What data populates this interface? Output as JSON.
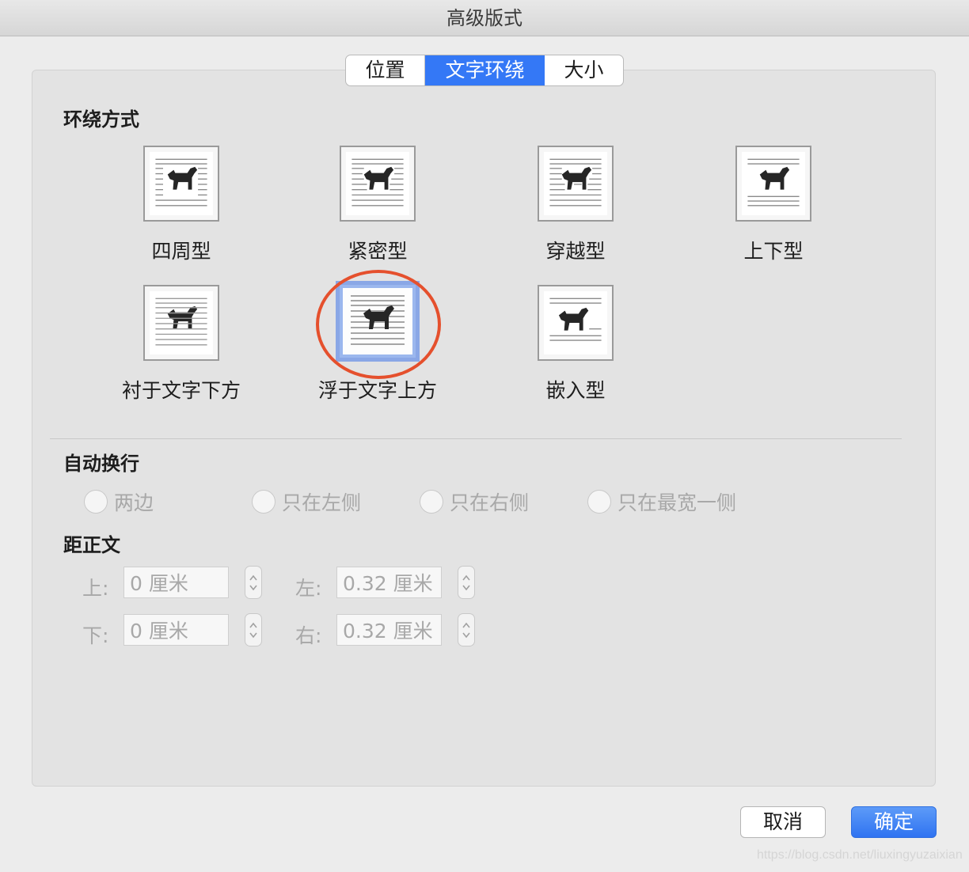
{
  "window": {
    "title": "高级版式"
  },
  "tabs": [
    {
      "label": "位置",
      "selected": false
    },
    {
      "label": "文字环绕",
      "selected": true
    },
    {
      "label": "大小",
      "selected": false
    }
  ],
  "wrap_style": {
    "heading": "环绕方式",
    "selected": "浮于文字上方",
    "options": [
      {
        "label": "四周型",
        "icon": "square-wrap-icon"
      },
      {
        "label": "紧密型",
        "icon": "tight-wrap-icon"
      },
      {
        "label": "穿越型",
        "icon": "through-wrap-icon"
      },
      {
        "label": "上下型",
        "icon": "top-bottom-wrap-icon"
      },
      {
        "label": "衬于文字下方",
        "icon": "behind-text-icon"
      },
      {
        "label": "浮于文字上方",
        "icon": "in-front-of-text-icon"
      },
      {
        "label": "嵌入型",
        "icon": "inline-icon"
      }
    ]
  },
  "auto_wrap": {
    "heading": "自动换行",
    "options": [
      "两边",
      "只在左侧",
      "只在右侧",
      "只在最宽一侧"
    ]
  },
  "distance": {
    "heading": "距正文",
    "top": {
      "label": "上:",
      "value": "0 厘米"
    },
    "left": {
      "label": "左:",
      "value": "0.32 厘米"
    },
    "bottom": {
      "label": "下:",
      "value": "0 厘米"
    },
    "right": {
      "label": "右:",
      "value": "0.32 厘米"
    }
  },
  "buttons": {
    "cancel": "取消",
    "ok": "确定"
  },
  "watermark": "https://blog.csdn.net/liuxingyuzaixian",
  "colors": {
    "accent": "#3478f6",
    "highlight_ring": "#e5502d",
    "selection": "#8aa7e6"
  }
}
